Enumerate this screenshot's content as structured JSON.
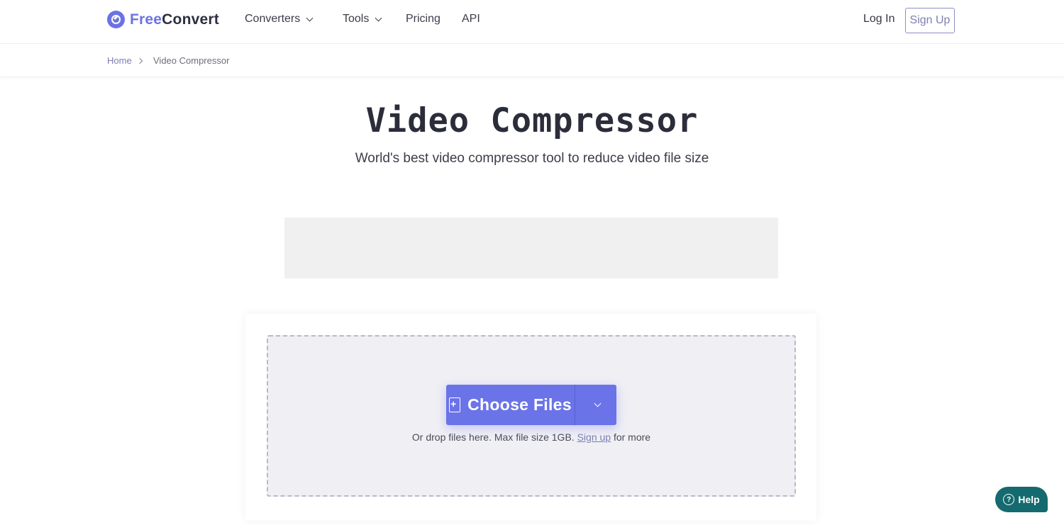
{
  "header": {
    "logo_part1": "Free",
    "logo_part2": "Convert",
    "nav": [
      {
        "label": "Converters",
        "has_dropdown": true
      },
      {
        "label": "Tools",
        "has_dropdown": true
      },
      {
        "label": "Pricing",
        "has_dropdown": false
      },
      {
        "label": "API",
        "has_dropdown": false
      }
    ],
    "login_label": "Log In",
    "signup_label": "Sign Up"
  },
  "breadcrumb": {
    "home": "Home",
    "current": "Video Compressor"
  },
  "main": {
    "title": "Video Compressor",
    "subtitle": "World's best video compressor tool to reduce video file size"
  },
  "upload": {
    "choose_label": "Choose Files",
    "hint_prefix": "Or drop files here. Max file size 1GB.",
    "hint_link": "Sign up",
    "hint_suffix": "for more"
  },
  "help": {
    "label": "Help",
    "icon": "?"
  },
  "colors": {
    "brand": "#6b73e8",
    "help": "#146a6e"
  }
}
